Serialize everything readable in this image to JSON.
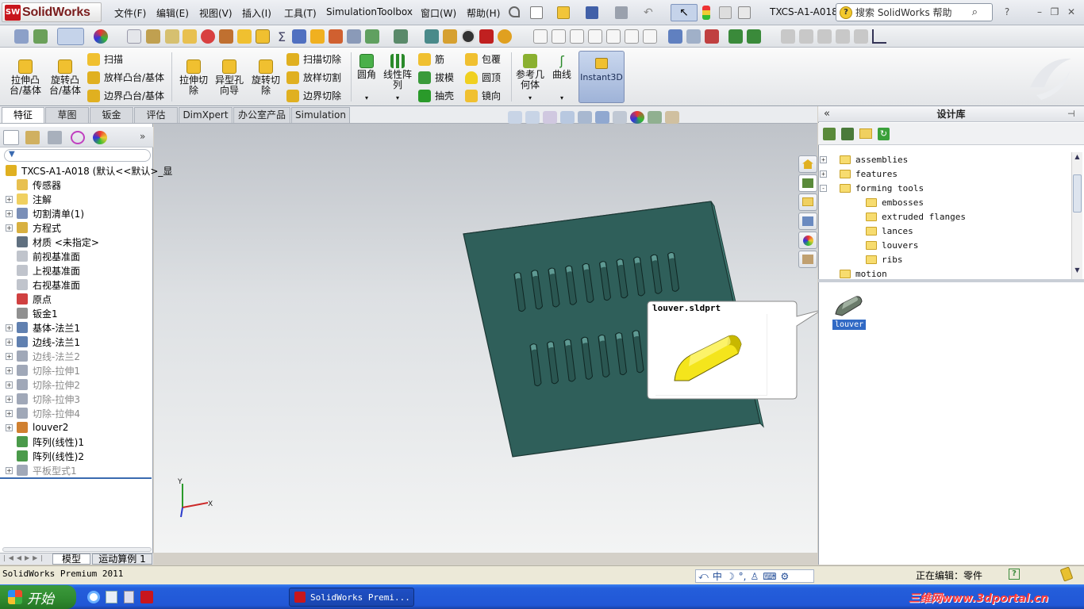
{
  "app": {
    "logo_text": "SolidWorks",
    "doc_title": "TXCS-A1-A018"
  },
  "menu": [
    "文件(F)",
    "编辑(E)",
    "视图(V)",
    "插入(I)",
    "工具(T)",
    "Simulation",
    "Toolbox",
    "窗口(W)",
    "帮助(H)"
  ],
  "search": {
    "placeholder": "搜索 SolidWorks 帮助"
  },
  "commands": {
    "extrude_boss": "拉伸凸\n台/基体",
    "revolve_boss": "旋转凸\n台/基体",
    "sweep": "扫描",
    "loft": "放样凸台/基体",
    "boundary": "边界凸台/基体",
    "extrude_cut": "拉伸切\n除",
    "hole_wizard": "异型孔\n向导",
    "revolve_cut": "旋转切\n除",
    "swept_cut": "扫描切除",
    "lofted_cut": "放样切割",
    "boundary_cut": "边界切除",
    "fillet": "圆角",
    "linear_pattern": "线性阵\n列",
    "rib": "筋",
    "draft": "拔模",
    "shell": "抽壳",
    "wrap": "包覆",
    "dome": "圆顶",
    "mirror": "镜向",
    "ref_geom": "参考几\n何体",
    "curves": "曲线",
    "instant3d": "Instant3D"
  },
  "tabs": [
    "特征",
    "草图",
    "钣金",
    "评估",
    "DimXpert",
    "办公室产品",
    "Simulation"
  ],
  "feature_tree": [
    {
      "label": "TXCS-A1-A018  (默认<<默认>_显",
      "expand": "",
      "dim": false,
      "color": "#e0b020"
    },
    {
      "label": "传感器",
      "expand": "",
      "dim": false,
      "color": "#e8c050"
    },
    {
      "label": "注解",
      "expand": "+",
      "dim": false,
      "color": "#f0d060"
    },
    {
      "label": "切割清单(1)",
      "expand": "+",
      "dim": false,
      "color": "#7a8fb8"
    },
    {
      "label": "方程式",
      "expand": "+",
      "dim": false,
      "color": "#d8b040"
    },
    {
      "label": "材质 <未指定>",
      "expand": "",
      "dim": false,
      "color": "#607080"
    },
    {
      "label": "前视基准面",
      "expand": "",
      "dim": false,
      "color": "#c0c4cc"
    },
    {
      "label": "上视基准面",
      "expand": "",
      "dim": false,
      "color": "#c0c4cc"
    },
    {
      "label": "右视基准面",
      "expand": "",
      "dim": false,
      "color": "#c0c4cc"
    },
    {
      "label": "原点",
      "expand": "",
      "dim": false,
      "color": "#d04040"
    },
    {
      "label": "钣金1",
      "expand": "",
      "dim": false,
      "color": "#909090"
    },
    {
      "label": "基体-法兰1",
      "expand": "+",
      "dim": false,
      "color": "#6080b0"
    },
    {
      "label": "边线-法兰1",
      "expand": "+",
      "dim": false,
      "color": "#6080b0"
    },
    {
      "label": "边线-法兰2",
      "expand": "+",
      "dim": true,
      "color": "#a0a8b8"
    },
    {
      "label": "切除-拉伸1",
      "expand": "+",
      "dim": true,
      "color": "#a0a8b8"
    },
    {
      "label": "切除-拉伸2",
      "expand": "+",
      "dim": true,
      "color": "#a0a8b8"
    },
    {
      "label": "切除-拉伸3",
      "expand": "+",
      "dim": true,
      "color": "#a0a8b8"
    },
    {
      "label": "切除-拉伸4",
      "expand": "+",
      "dim": true,
      "color": "#a0a8b8"
    },
    {
      "label": "louver2",
      "expand": "+",
      "dim": false,
      "color": "#d08030"
    },
    {
      "label": "阵列(线性)1",
      "expand": "",
      "dim": false,
      "color": "#4a9a4a"
    },
    {
      "label": "阵列(线性)2",
      "expand": "",
      "dim": false,
      "color": "#4a9a4a"
    },
    {
      "label": "平板型式1",
      "expand": "+",
      "dim": true,
      "color": "#a0a8b8"
    }
  ],
  "model_tabs": [
    "模型",
    "运动算例 1"
  ],
  "design_library": {
    "title": "设计库",
    "tree": [
      {
        "label": "assemblies",
        "expand": "+",
        "indent": 0
      },
      {
        "label": "features",
        "expand": "+",
        "indent": 0
      },
      {
        "label": "forming tools",
        "expand": "-",
        "indent": 0
      },
      {
        "label": "embosses",
        "expand": "",
        "indent": 1
      },
      {
        "label": "extruded flanges",
        "expand": "",
        "indent": 1
      },
      {
        "label": "lances",
        "expand": "",
        "indent": 1
      },
      {
        "label": "louvers",
        "expand": "",
        "indent": 1
      },
      {
        "label": "ribs",
        "expand": "",
        "indent": 1
      },
      {
        "label": "motion",
        "expand": "",
        "indent": 0
      }
    ],
    "item_label": "louver"
  },
  "tooltip": {
    "title": "louver.sldprt"
  },
  "axes": {
    "x": "X",
    "y": "Y"
  },
  "status": {
    "left": "SolidWorks Premium 2011",
    "editing": "正在编辑：零件"
  },
  "taskbar": {
    "start": "开始",
    "app_button": "SolidWorks Premi...",
    "watermark": "三维网www.3dportal.cn"
  },
  "colors": {
    "part_face": "#2f5f5a",
    "part_edge": "#3e7a72",
    "part_top": "#6aa8a2",
    "accent": "#316ac5"
  }
}
